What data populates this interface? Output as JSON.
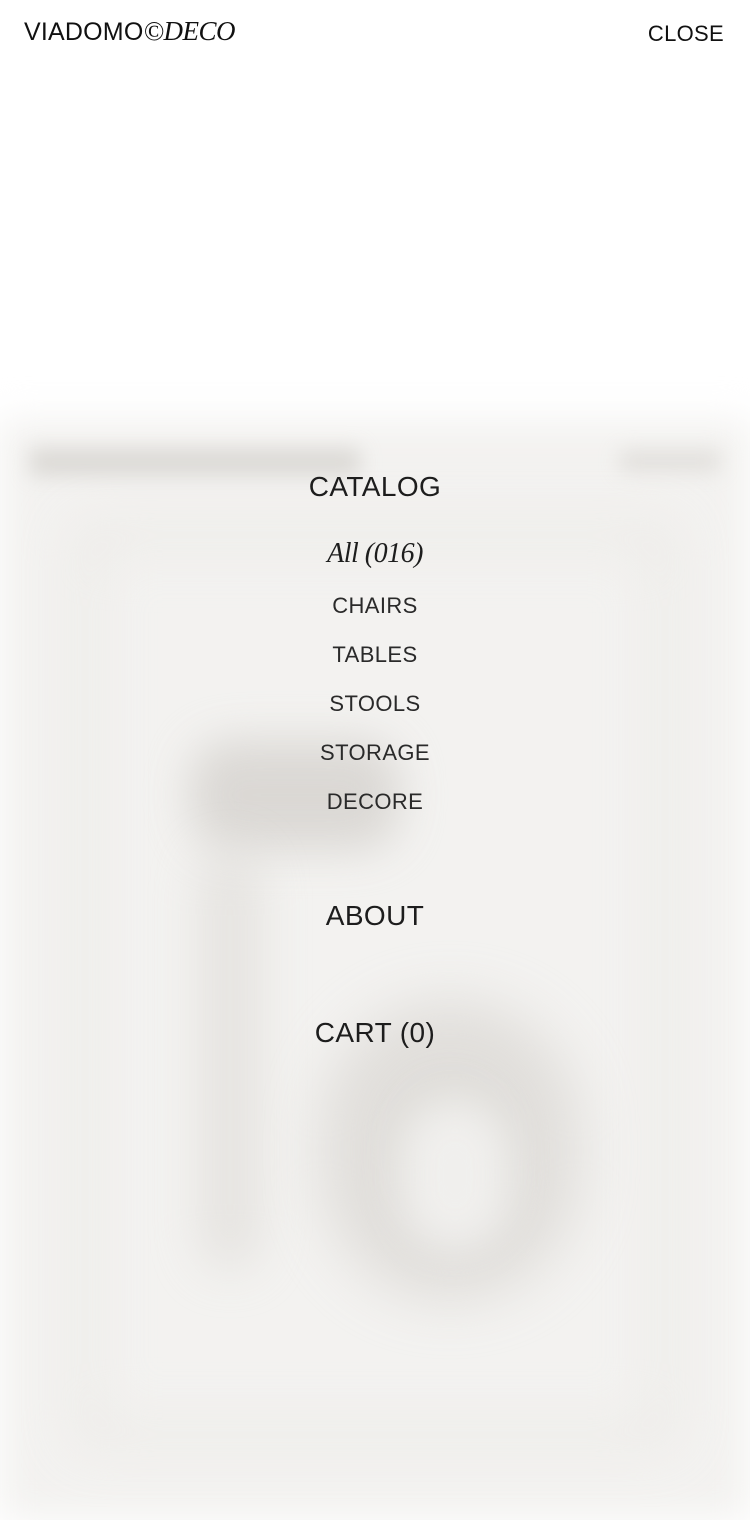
{
  "header": {
    "logo_main": "VIADOMO",
    "logo_accent": "©DECO",
    "close_label": "CLOSE"
  },
  "menu": {
    "catalog_label": "CATALOG",
    "all_label": "All (016)",
    "categories": [
      {
        "label": "CHAIRS"
      },
      {
        "label": "TABLES"
      },
      {
        "label": "STOOLS"
      },
      {
        "label": "STORAGE"
      },
      {
        "label": "DECORE"
      }
    ],
    "about_label": "ABOUT",
    "cart_label": "CART (0)"
  }
}
